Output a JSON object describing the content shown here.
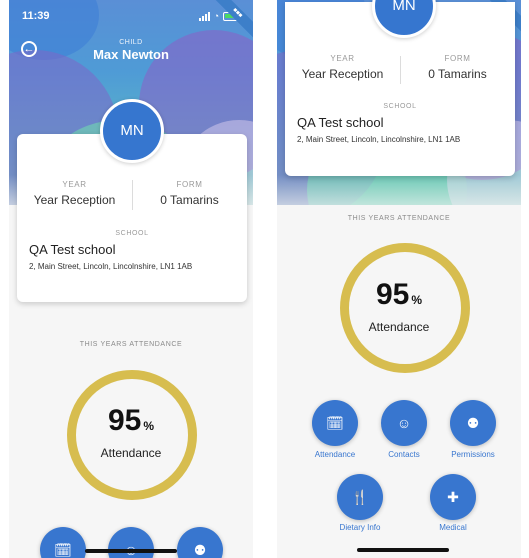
{
  "left": {
    "status": {
      "time": "11:39"
    },
    "child_label": "CHILD",
    "child_name": "Max Newton",
    "initials": "MN",
    "year_label": "YEAR",
    "year_value": "Year Reception",
    "form_label": "FORM",
    "form_value": "0 Tamarins",
    "school_label": "SCHOOL",
    "school_name": "QA Test school",
    "school_address": "2, Main Street, Lincoln, Lincolnshire, LN1 1AB",
    "attendance_title": "THIS YEARS ATTENDANCE",
    "attendance_value": "95",
    "attendance_unit": "%",
    "attendance_label": "Attendance",
    "attendance_fraction": 0.95
  },
  "right": {
    "initials": "MN",
    "year_label": "YEAR",
    "year_value": "Year Reception",
    "form_label": "FORM",
    "form_value": "0 Tamarins",
    "school_label": "SCHOOL",
    "school_name": "QA Test school",
    "school_address": "2, Main Street, Lincoln, Lincolnshire, LN1 1AB",
    "attendance_title": "THIS YEARS ATTENDANCE",
    "attendance_value": "95",
    "attendance_unit": "%",
    "attendance_label": "Attendance",
    "actions": [
      {
        "label": "Attendance",
        "icon": "calendar-check-icon"
      },
      {
        "label": "Contacts",
        "icon": "people-icon"
      },
      {
        "label": "Permissions",
        "icon": "user-shield-icon"
      },
      {
        "label": "Dietary Info",
        "icon": "cutlery-icon"
      },
      {
        "label": "Medical",
        "icon": "medical-kit-icon"
      }
    ]
  },
  "colors": {
    "primary": "#3876cf",
    "ring": "#d7bd4f"
  }
}
